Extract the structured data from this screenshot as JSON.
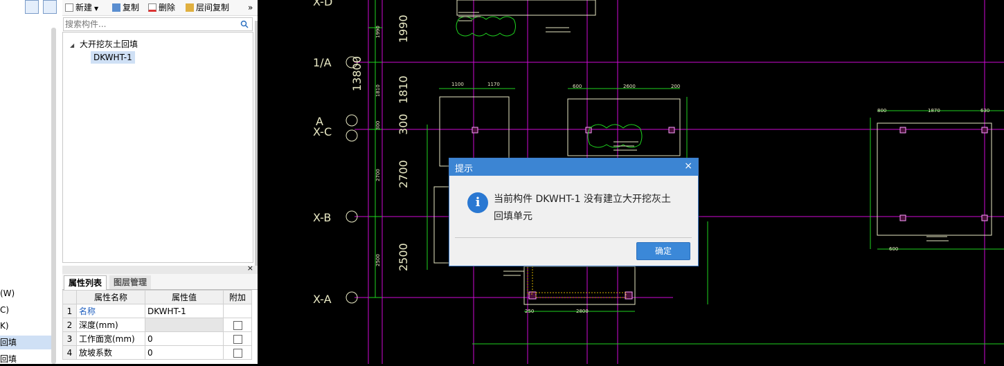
{
  "left_nav": {
    "items": [
      "(W)",
      "C)",
      "K)",
      "回填",
      "回填"
    ]
  },
  "toolbar": {
    "new_label": "新建",
    "copy_label": "复制",
    "delete_label": "删除",
    "floor_copy_label": "层间复制",
    "more_label": "»"
  },
  "search": {
    "placeholder": "搜索构件..."
  },
  "tree": {
    "root": "大开挖灰土回填",
    "child": "DKWHT-1"
  },
  "props": {
    "tab_list": "属性列表",
    "tab_layers": "图层管理",
    "headers": [
      "属性名称",
      "属性值",
      "附加"
    ],
    "rows": [
      {
        "n": "1",
        "name": "名称",
        "value": "DKWHT-1"
      },
      {
        "n": "2",
        "name": "深度(mm)",
        "value": ""
      },
      {
        "n": "3",
        "name": "工作面宽(mm)",
        "value": "0"
      },
      {
        "n": "4",
        "name": "放坡系数",
        "value": "0"
      }
    ],
    "close": "×"
  },
  "cad": {
    "axes": [
      "X-D",
      "1/A",
      "A",
      "X-C",
      "X-B",
      "X-A"
    ],
    "big_dims": [
      "1990",
      "13800",
      "1810",
      "300",
      "2700",
      "2500"
    ],
    "small_dims": [
      "1990",
      "1810",
      "300",
      "2700",
      "2500",
      "1100",
      "1170",
      "600",
      "2600",
      "200",
      "800",
      "1870",
      "630",
      "2800",
      "250",
      "600"
    ],
    "colors": {
      "grid": "#d10ad6",
      "dim": "#1fd51f",
      "line": "#e9e9c4",
      "bg": "#000000"
    }
  },
  "dialog": {
    "title": "提示",
    "close": "×",
    "icon": "i",
    "message_line1": "当前构件 DKWHT-1 没有建立大开挖灰土",
    "message_line2": "回填单元",
    "ok": "确定"
  }
}
